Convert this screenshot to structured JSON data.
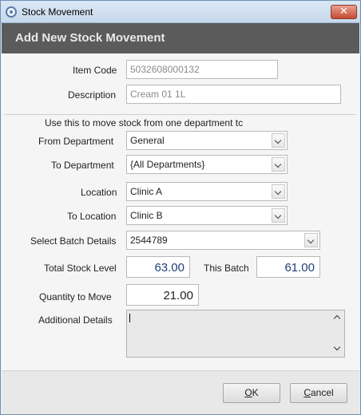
{
  "window": {
    "title": "Stock Movement"
  },
  "header": {
    "title": "Add New Stock Movement"
  },
  "form": {
    "item_code_label": "Item Code",
    "item_code_value": "5032608000132",
    "description_label": "Description",
    "description_value": "Cream 01 1L",
    "hint": "Use this to move stock from one department tc",
    "from_department_label": "From Department",
    "from_department_value": "General",
    "to_department_label": "To Department",
    "to_department_value": "{All Departments}",
    "location_label": "Location",
    "location_value": "Clinic A",
    "to_location_label": "To Location",
    "to_location_value": "Clinic B",
    "batch_label": "Select Batch Details",
    "batch_value": "2544789",
    "total_stock_label": "Total Stock Level",
    "total_stock_value": "63.00",
    "this_batch_label": "This Batch",
    "this_batch_value": "61.00",
    "quantity_label": "Quantity to Move",
    "quantity_value": "21.00",
    "additional_label": "Additional Details",
    "additional_value": ""
  },
  "buttons": {
    "ok_mnemonic": "O",
    "ok_rest": "K",
    "cancel_mnemonic": "C",
    "cancel_rest": "ancel"
  }
}
